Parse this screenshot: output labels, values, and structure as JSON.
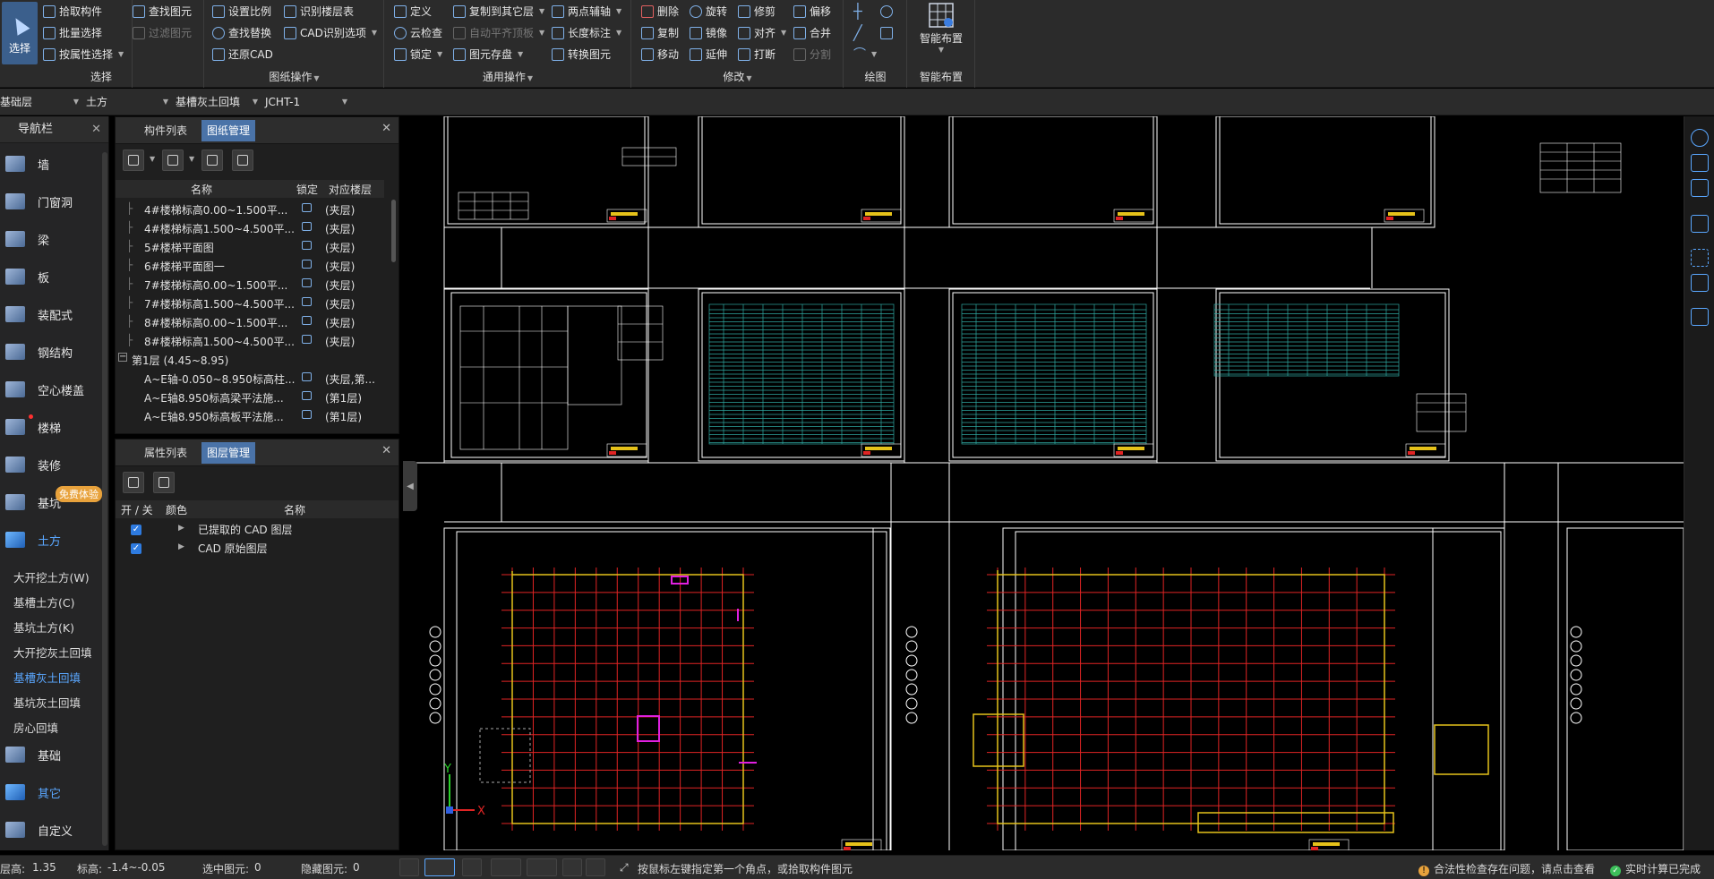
{
  "ribbon": {
    "select": {
      "label": "选择"
    },
    "groups": {
      "select": "选择",
      "drawing_ops": "图纸操作",
      "common_ops": "通用操作",
      "modify": "修改",
      "draw": "绘图",
      "smart_layout": "智能布置"
    },
    "buttons": {
      "pick_component": "拾取构件",
      "batch_select": "批量选择",
      "select_by_attr": "按属性选择",
      "find_element": "查找图元",
      "filter_element": "过滤图元",
      "set_scale": "设置比例",
      "find_replace": "查找替换",
      "restore_cad": "还原CAD",
      "identify_floor_table": "识别楼层表",
      "cad_identify_options": "CAD识别选项",
      "define": "定义",
      "cloud_check": "云检查",
      "lock": "锁定",
      "copy_to_other_floor": "复制到其它层",
      "auto_flat_top": "自动平齐顶板",
      "element_save": "图元存盘",
      "two_point_axis": "两点辅轴",
      "length_dim": "长度标注",
      "convert_element": "转换图元",
      "delete": "删除",
      "copy": "复制",
      "move": "移动",
      "rotate": "旋转",
      "mirror": "镜像",
      "extend": "延伸",
      "trim": "修剪",
      "align": "对齐",
      "break": "打断",
      "offset": "偏移",
      "merge": "合并",
      "split": "分割",
      "smart_layout": "智能布置"
    }
  },
  "toolbar2": {
    "floor": "基础层",
    "category": "土方",
    "component_type": "基槽灰土回填",
    "component": "JCHT-1"
  },
  "nav": {
    "title": "导航栏",
    "items": [
      {
        "label": "墙",
        "icon": "wall-icon"
      },
      {
        "label": "门窗洞",
        "icon": "door-window-icon"
      },
      {
        "label": "梁",
        "icon": "beam-icon"
      },
      {
        "label": "板",
        "icon": "slab-icon"
      },
      {
        "label": "装配式",
        "icon": "prefab-icon"
      },
      {
        "label": "钢结构",
        "icon": "steel-structure-icon"
      },
      {
        "label": "空心楼盖",
        "icon": "hollow-floor-icon"
      },
      {
        "label": "楼梯",
        "icon": "stair-icon"
      },
      {
        "label": "装修",
        "icon": "decoration-icon"
      },
      {
        "label": "基坑",
        "icon": "foundation-pit-icon"
      },
      {
        "label": "土方",
        "icon": "earthwork-icon"
      }
    ],
    "badge": "免费体验",
    "sub_items": [
      "大开挖土方(W)",
      "基槽土方(C)",
      "基坑土方(K)",
      "大开挖灰土回填",
      "基槽灰土回填",
      "基坑灰土回填",
      "房心回填"
    ],
    "bottom_items": [
      {
        "label": "基础",
        "icon": "foundation-icon"
      },
      {
        "label": "其它",
        "icon": "other-icon"
      },
      {
        "label": "自定义",
        "icon": "custom-icon"
      }
    ]
  },
  "drawing_panel": {
    "tabs": [
      "构件列表",
      "图纸管理"
    ],
    "columns": [
      "名称",
      "锁定",
      "对应楼层"
    ],
    "rows": [
      {
        "name": "4#楼梯标高0.00~1.500平...",
        "floor": "(夹层)"
      },
      {
        "name": "4#楼梯标高1.500~4.500平...",
        "floor": "(夹层)"
      },
      {
        "name": "5#楼梯平面图",
        "floor": "(夹层)"
      },
      {
        "name": "6#楼梯平面图一",
        "floor": "(夹层)"
      },
      {
        "name": "7#楼梯标高0.00~1.500平...",
        "floor": "(夹层)"
      },
      {
        "name": "7#楼梯标高1.500~4.500平...",
        "floor": "(夹层)"
      },
      {
        "name": "8#楼梯标高0.00~1.500平...",
        "floor": "(夹层)"
      },
      {
        "name": "8#楼梯标高1.500~4.500平...",
        "floor": "(夹层)"
      }
    ],
    "group": "第1层 (4.45~8.95)",
    "group_rows": [
      {
        "name": "A~E轴-0.050~8.950标高柱...",
        "floor": "(夹层,第..."
      },
      {
        "name": "A~E轴8.950标高梁平法施...",
        "floor": "(第1层)"
      },
      {
        "name": "A~E轴8.950标高板平法施...",
        "floor": "(第1层)"
      }
    ]
  },
  "layer_panel": {
    "tabs": [
      "属性列表",
      "图层管理"
    ],
    "columns": [
      "开 / 关",
      "颜色",
      "名称"
    ],
    "rows": [
      "已提取的 CAD 图层",
      "CAD 原始图层"
    ]
  },
  "canvas": {
    "axis_x": "X",
    "axis_y": "Y",
    "colors": {
      "frame": "#ffffff",
      "grid_red": "#e02424",
      "table_cyan": "#2fa7a0",
      "wall_yellow": "#e6c21a",
      "magenta": "#e020e0"
    }
  },
  "status": {
    "floor_height_label": "层高:",
    "floor_height": "1.35",
    "elevation_label": "标高:",
    "elevation": "-1.4~-0.05",
    "selected_label": "选中图元:",
    "selected": "0",
    "hidden_label": "隐藏图元:",
    "hidden": "0",
    "hint": "按鼠标左键指定第一个角点，或拾取构件图元",
    "legality_warning": "合法性检查存在问题，请点击查看",
    "realtime_done": "实时计算已完成"
  }
}
